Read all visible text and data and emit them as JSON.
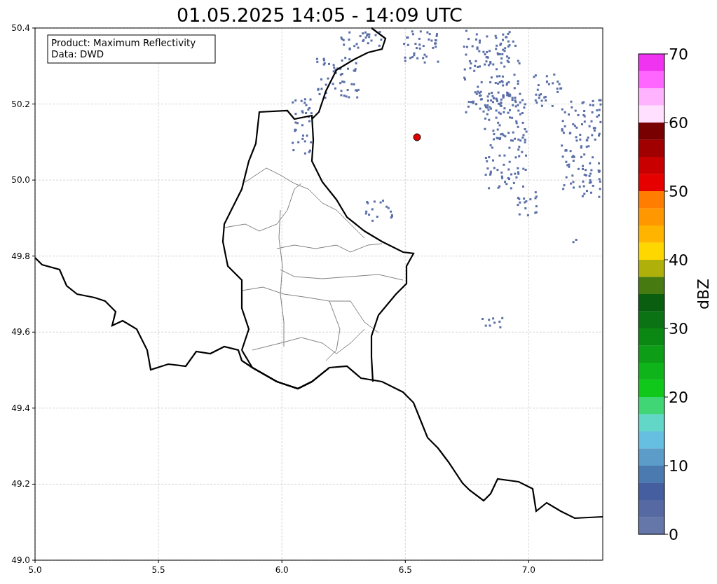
{
  "title": "01.05.2025 14:05 - 14:09 UTC",
  "info_box": {
    "lines": [
      "Product: Maximum Reflectivity",
      "Data: DWD"
    ]
  },
  "map": {
    "x_ticks": [
      "5.0",
      "5.5",
      "6.0",
      "6.5",
      "7.0"
    ],
    "y_ticks": [
      "50.4",
      "50.2",
      "50.0",
      "49.8",
      "49.6",
      "49.4",
      "49.2",
      "49.0"
    ]
  },
  "colorbar": {
    "ticks": [
      "70",
      "60",
      "50",
      "40",
      "30",
      "20",
      "10",
      "0"
    ],
    "label": "dBZ",
    "segments": [
      {
        "color": "#f033f0"
      },
      {
        "color": "#ff66ff"
      },
      {
        "color": "#ffb3ff"
      },
      {
        "color": "#ffe0ff"
      },
      {
        "color": "#780000"
      },
      {
        "color": "#a00000"
      },
      {
        "color": "#c80000"
      },
      {
        "color": "#e60000"
      },
      {
        "color": "#ff7d00"
      },
      {
        "color": "#ff9800"
      },
      {
        "color": "#ffb400"
      },
      {
        "color": "#ffd700"
      },
      {
        "color": "#b0b00a"
      },
      {
        "color": "#477a10"
      },
      {
        "color": "#0a5e10"
      },
      {
        "color": "#0b7313"
      },
      {
        "color": "#0b8813"
      },
      {
        "color": "#0d9d17"
      },
      {
        "color": "#0fb41a"
      },
      {
        "color": "#10c81a"
      },
      {
        "color": "#40d676"
      },
      {
        "color": "#62d6c7"
      },
      {
        "color": "#66bee0"
      },
      {
        "color": "#5b9cc8"
      },
      {
        "color": "#4a7ab0"
      },
      {
        "color": "#445ea0"
      },
      {
        "color": "#5669a2"
      },
      {
        "color": "#6577a8"
      }
    ]
  }
}
